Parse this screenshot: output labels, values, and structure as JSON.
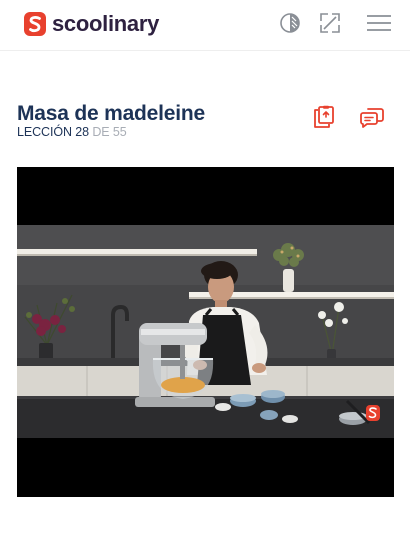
{
  "header": {
    "brand": "scoolinary",
    "brand_color": "#e8412e",
    "icons": {
      "contrast": "contrast-icon",
      "expand": "expand-icon",
      "menu": "menu-icon"
    }
  },
  "lesson": {
    "title": "Masa de madeleine",
    "lesson_label": "LECCIÓN",
    "current": "28",
    "of_label": "DE",
    "total": "55",
    "actions": {
      "resources": "clipboard-icon",
      "comments": "chat-icon"
    }
  },
  "video": {
    "description": "cooking lesson video frame",
    "watermark": "scoolinary-mark"
  }
}
